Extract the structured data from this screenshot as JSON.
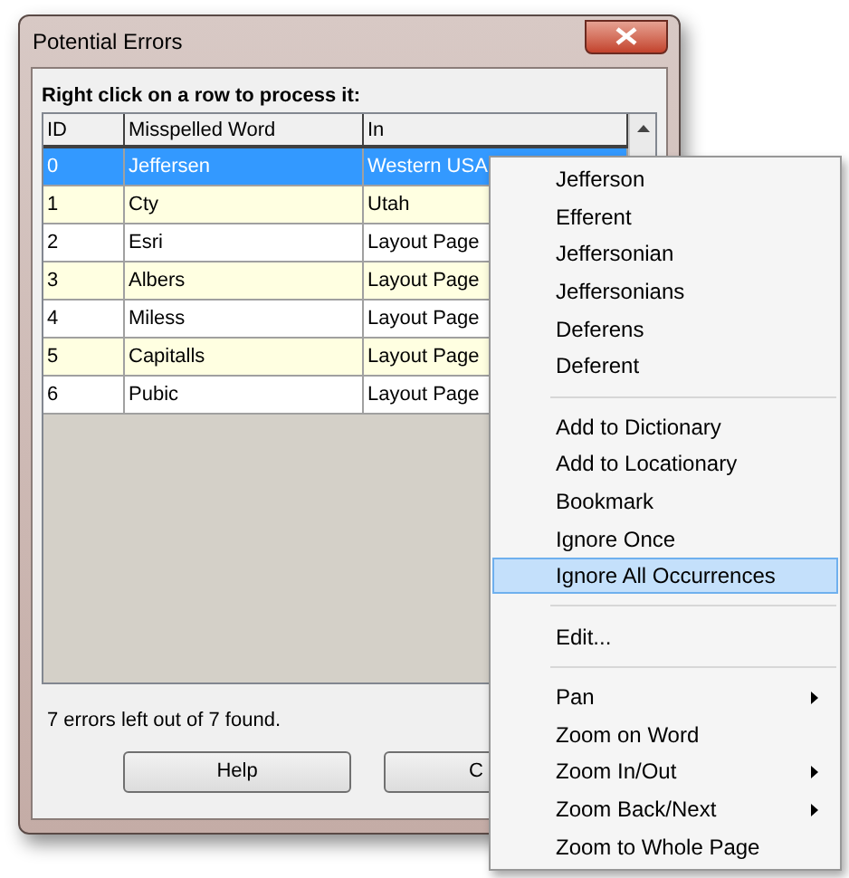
{
  "window": {
    "title": "Potential Errors"
  },
  "instruction": "Right click on a row to process it:",
  "table": {
    "columns": [
      "ID",
      "Misspelled Word",
      "In"
    ],
    "rows": [
      {
        "cells": [
          "0",
          "Jeffersen",
          "Western USA"
        ],
        "selected": true
      },
      {
        "cells": [
          "1",
          "Cty",
          "Utah"
        ],
        "selected": false
      },
      {
        "cells": [
          "2",
          "Esri",
          "Layout Page"
        ],
        "selected": false
      },
      {
        "cells": [
          "3",
          "Albers",
          "Layout Page"
        ],
        "selected": false
      },
      {
        "cells": [
          "4",
          "Miless",
          "Layout Page"
        ],
        "selected": false
      },
      {
        "cells": [
          "5",
          "Capitalls",
          "Layout Page"
        ],
        "selected": false
      },
      {
        "cells": [
          "6",
          "Pubic",
          "Layout Page"
        ],
        "selected": false
      }
    ]
  },
  "status": "7 errors left out of 7 found.",
  "buttons": [
    "Help",
    "C"
  ],
  "context_menu": [
    {
      "kind": "item",
      "label": "Jefferson",
      "selected": false,
      "submenu": false
    },
    {
      "kind": "item",
      "label": "Efferent",
      "selected": false,
      "submenu": false
    },
    {
      "kind": "item",
      "label": "Jeffersonian",
      "selected": false,
      "submenu": false
    },
    {
      "kind": "item",
      "label": "Jeffersonians",
      "selected": false,
      "submenu": false
    },
    {
      "kind": "item",
      "label": "Deferens",
      "selected": false,
      "submenu": false
    },
    {
      "kind": "item",
      "label": "Deferent",
      "selected": false,
      "submenu": false
    },
    {
      "kind": "separator"
    },
    {
      "kind": "item",
      "label": "Add to Dictionary",
      "selected": false,
      "submenu": false
    },
    {
      "kind": "item",
      "label": "Add to Locationary",
      "selected": false,
      "submenu": false
    },
    {
      "kind": "item",
      "label": "Bookmark",
      "selected": false,
      "submenu": false
    },
    {
      "kind": "item",
      "label": "Ignore Once",
      "selected": false,
      "submenu": false
    },
    {
      "kind": "item",
      "label": "Ignore All Occurrences",
      "selected": true,
      "submenu": false
    },
    {
      "kind": "separator"
    },
    {
      "kind": "item",
      "label": "Edit...",
      "selected": false,
      "submenu": false
    },
    {
      "kind": "separator"
    },
    {
      "kind": "item",
      "label": "Pan",
      "selected": false,
      "submenu": true
    },
    {
      "kind": "item",
      "label": "Zoom on Word",
      "selected": false,
      "submenu": false
    },
    {
      "kind": "item",
      "label": "Zoom In/Out",
      "selected": false,
      "submenu": true
    },
    {
      "kind": "item",
      "label": "Zoom Back/Next",
      "selected": false,
      "submenu": true
    },
    {
      "kind": "item",
      "label": "Zoom to Whole Page",
      "selected": false,
      "submenu": false
    }
  ]
}
